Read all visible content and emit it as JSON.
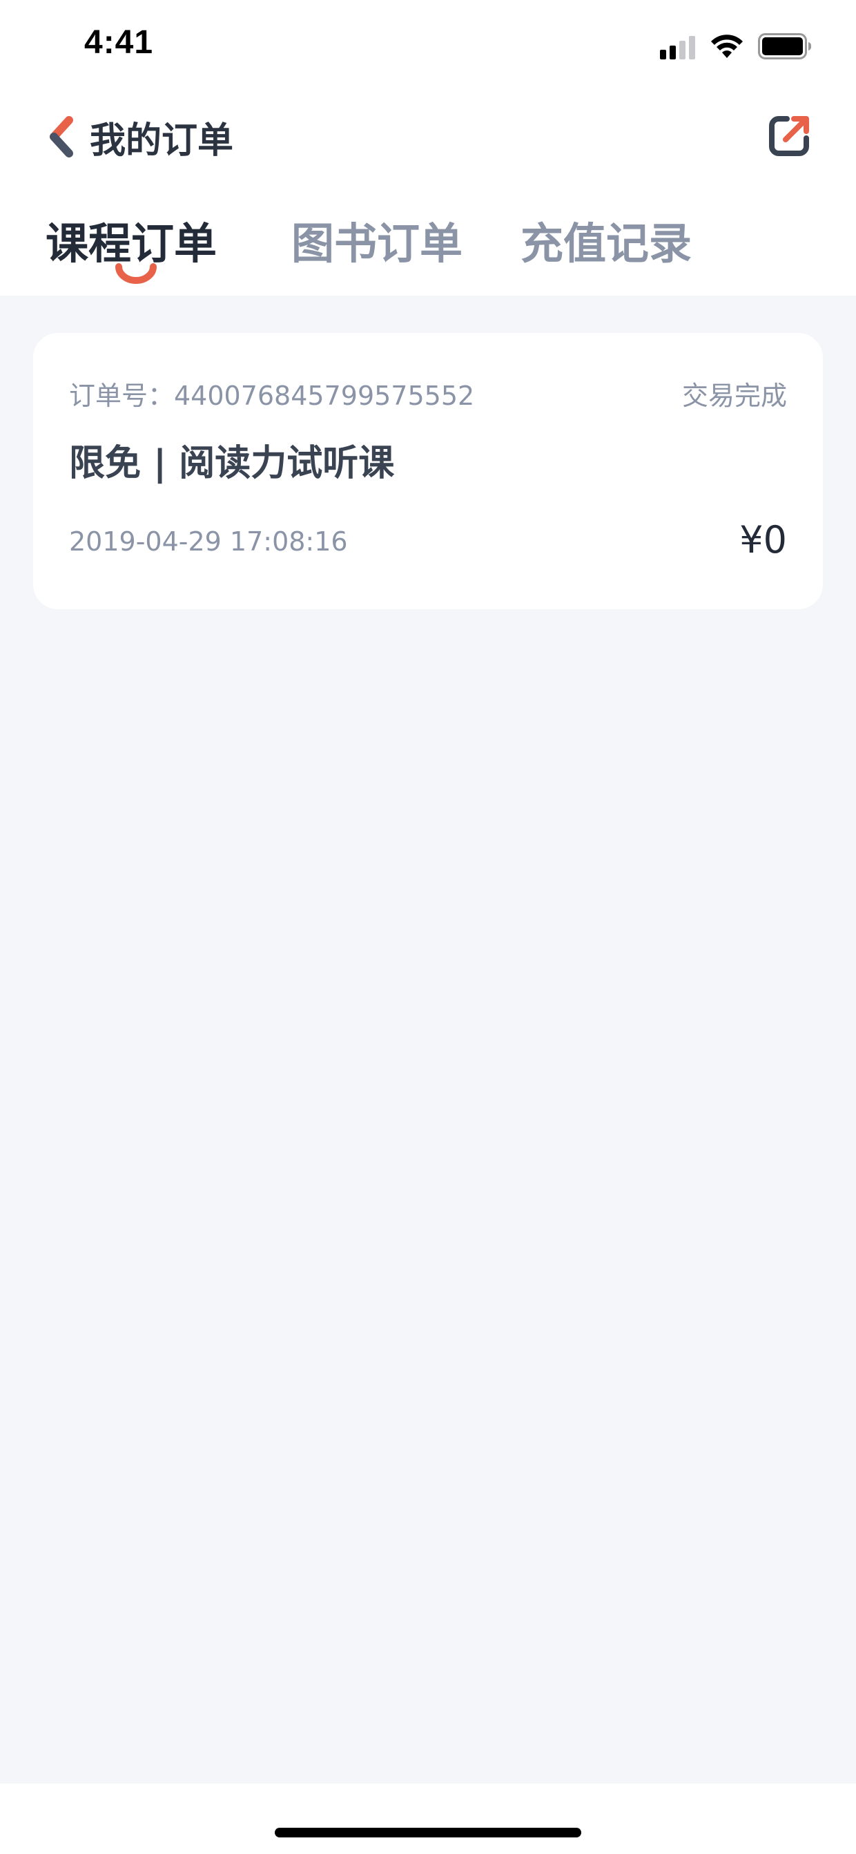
{
  "status_bar": {
    "time": "4:41"
  },
  "nav": {
    "title": "我的订单",
    "back_icon": "chevron-left-icon",
    "share_icon": "share-external-icon",
    "accent_color": "#E8624A"
  },
  "tabs": [
    {
      "label": "课程订单",
      "active": true
    },
    {
      "label": "图书订单",
      "active": false
    },
    {
      "label": "充值记录",
      "active": false
    }
  ],
  "orders": [
    {
      "number_label": "订单号：440076845799575552",
      "status": "交易完成",
      "title": "限免 | 阅读力试听课",
      "time": "2019-04-29 17:08:16",
      "price": "¥0"
    }
  ]
}
